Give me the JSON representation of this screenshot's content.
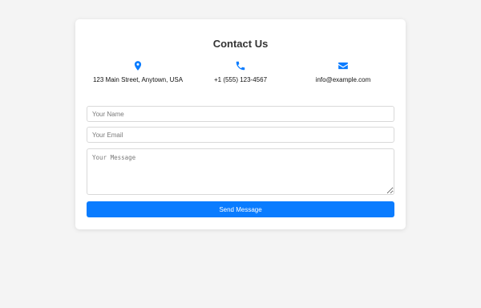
{
  "contact": {
    "title": "Contact Us",
    "accent_color": "#0a7cff",
    "info": [
      {
        "icon": "location-pin-icon",
        "text": "123 Main Street, Anytown, USA"
      },
      {
        "icon": "phone-icon",
        "text": "+1 (555) 123-4567"
      },
      {
        "icon": "envelope-icon",
        "text": "info@example.com"
      }
    ]
  },
  "form": {
    "name_placeholder": "Your Name",
    "email_placeholder": "Your Email",
    "message_placeholder": "Your Message",
    "submit_label": "Send Message"
  }
}
